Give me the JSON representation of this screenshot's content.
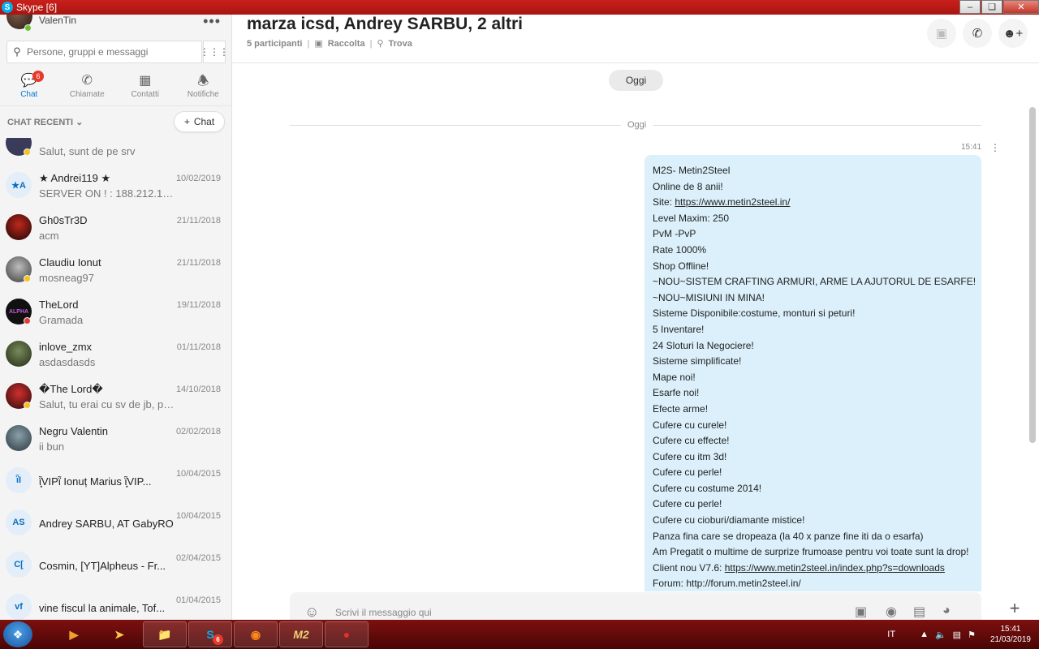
{
  "window": {
    "title": "Skype [6]"
  },
  "profile": {
    "name": "ValenTin",
    "more_icon": "more-icon"
  },
  "search": {
    "placeholder": "Persone, gruppi e messaggi"
  },
  "tabs": [
    {
      "label": "Chat",
      "icon": "chat-icon",
      "badge": "6",
      "active": true
    },
    {
      "label": "Chiamate",
      "icon": "phone-icon"
    },
    {
      "label": "Contatti",
      "icon": "contacts-icon"
    },
    {
      "label": "Notifiche",
      "icon": "bell-icon"
    }
  ],
  "recent": {
    "label": "CHAT RECENTI",
    "new_chat_label": "Chat"
  },
  "chats": [
    {
      "name": "",
      "preview": "Salut, sunt de pe srv",
      "date": ""
    },
    {
      "name": "★ Andrei119 ★",
      "preview": "SERVER ON ! : 188.212.100....",
      "date": "10/02/2019",
      "initials": "★A"
    },
    {
      "name": "Gh0sTr3D",
      "preview": "acm",
      "date": "21/11/2018"
    },
    {
      "name": "Claudiu Ionut",
      "preview": "mosneag97",
      "date": "21/11/2018"
    },
    {
      "name": "TheLord",
      "preview": "Gramada",
      "date": "19/11/2018"
    },
    {
      "name": "inlove_zmx",
      "preview": "asdasdasds",
      "date": "01/11/2018"
    },
    {
      "name": "�The Lord�",
      "preview": "Salut, tu erai cu sv de jb, pa...",
      "date": "14/10/2018"
    },
    {
      "name": "Negru Valentin",
      "preview": "ii bun",
      "date": "02/02/2018"
    },
    {
      "name": "ῗ͙͙VIPῗ Ionuț Marius ῗ͙͙VIP...",
      "preview": "",
      "date": "10/04/2015",
      "initials": "ῗI"
    },
    {
      "name": "Andrey SARBU, AT GabyRO",
      "preview": "",
      "date": "10/04/2015",
      "initials": "AS"
    },
    {
      "name": "Cosmin, [YT]Alpheus - Fr...",
      "preview": "",
      "date": "02/04/2015",
      "initials": "C["
    },
    {
      "name": "vine fiscul la animale, Tof...",
      "preview": "",
      "date": "01/04/2015",
      "initials": "vf"
    }
  ],
  "conversation": {
    "title": "marza icsd, Andrey SARBU, 2 altri",
    "participants": "5 participanti",
    "gallery": "Raccolta",
    "find": "Trova",
    "day_pill": "Oggi",
    "day_separator": "Oggi",
    "message_time": "15:41",
    "message_lines": [
      "M2S- Metin2Steel",
      "Online de 8 anii!",
      "Site: |https://www.metin2steel.in/",
      "Level Maxim: 250",
      "PvM -PvP",
      "Rate 1000%",
      "Shop Offline!",
      "~NOU~SISTEM CRAFTING ARMURI, ARME LA AJUTORUL DE ESARFE!",
      "~NOU~MISIUNI IN MINA!",
      "Sisteme Disponibile:costume, monturi si peturi!",
      "5 Inventare!",
      "24 Sloturi la Negociere!",
      "Sisteme simplificate!",
      "Mape noi!",
      "Esarfe noi!",
      "Efecte arme!",
      "Cufere cu curele!",
      "Cufere cu effecte!",
      "Cufere cu itm 3d!",
      "Cufere cu perle!",
      "Cufere cu costume 2014!",
      "Cufere cu perle!",
      "Cufere cu cioburi/diamante mistice!",
      "Panza fina care se dropeaza (la 40 x panze fine iti da o esarfa)",
      "Am Pregatit o multime de surprize frumoase pentru voi toate sunt la drop!",
      "Client nou V7.6: |https://www.metin2steel.in/index.php?s=downloads",
      "Forum: http://forum.metin2steel.in/"
    ],
    "composer_placeholder": "Scrivi il messaggio qui"
  },
  "taskbar": {
    "lang": "IT",
    "time": "15:41",
    "date": "21/03/2019",
    "skype_badge": "6",
    "m2_label": "M2"
  },
  "colors": {
    "accent": "#0078d4",
    "bubble": "#dbf0fb",
    "titlebar": "#b81a14",
    "badge": "#e8382a"
  }
}
